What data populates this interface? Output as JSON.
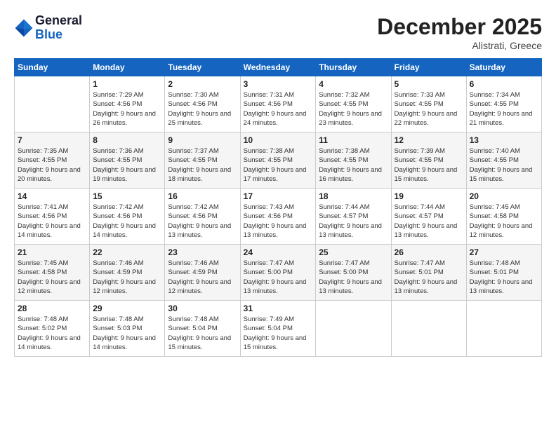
{
  "header": {
    "logo_line1": "General",
    "logo_line2": "Blue",
    "month": "December 2025",
    "location": "Alistrati, Greece"
  },
  "weekdays": [
    "Sunday",
    "Monday",
    "Tuesday",
    "Wednesday",
    "Thursday",
    "Friday",
    "Saturday"
  ],
  "weeks": [
    [
      {
        "day": "",
        "sunrise": "",
        "sunset": "",
        "daylight": ""
      },
      {
        "day": "1",
        "sunrise": "Sunrise: 7:29 AM",
        "sunset": "Sunset: 4:56 PM",
        "daylight": "Daylight: 9 hours and 26 minutes."
      },
      {
        "day": "2",
        "sunrise": "Sunrise: 7:30 AM",
        "sunset": "Sunset: 4:56 PM",
        "daylight": "Daylight: 9 hours and 25 minutes."
      },
      {
        "day": "3",
        "sunrise": "Sunrise: 7:31 AM",
        "sunset": "Sunset: 4:56 PM",
        "daylight": "Daylight: 9 hours and 24 minutes."
      },
      {
        "day": "4",
        "sunrise": "Sunrise: 7:32 AM",
        "sunset": "Sunset: 4:55 PM",
        "daylight": "Daylight: 9 hours and 23 minutes."
      },
      {
        "day": "5",
        "sunrise": "Sunrise: 7:33 AM",
        "sunset": "Sunset: 4:55 PM",
        "daylight": "Daylight: 9 hours and 22 minutes."
      },
      {
        "day": "6",
        "sunrise": "Sunrise: 7:34 AM",
        "sunset": "Sunset: 4:55 PM",
        "daylight": "Daylight: 9 hours and 21 minutes."
      }
    ],
    [
      {
        "day": "7",
        "sunrise": "Sunrise: 7:35 AM",
        "sunset": "Sunset: 4:55 PM",
        "daylight": "Daylight: 9 hours and 20 minutes."
      },
      {
        "day": "8",
        "sunrise": "Sunrise: 7:36 AM",
        "sunset": "Sunset: 4:55 PM",
        "daylight": "Daylight: 9 hours and 19 minutes."
      },
      {
        "day": "9",
        "sunrise": "Sunrise: 7:37 AM",
        "sunset": "Sunset: 4:55 PM",
        "daylight": "Daylight: 9 hours and 18 minutes."
      },
      {
        "day": "10",
        "sunrise": "Sunrise: 7:38 AM",
        "sunset": "Sunset: 4:55 PM",
        "daylight": "Daylight: 9 hours and 17 minutes."
      },
      {
        "day": "11",
        "sunrise": "Sunrise: 7:38 AM",
        "sunset": "Sunset: 4:55 PM",
        "daylight": "Daylight: 9 hours and 16 minutes."
      },
      {
        "day": "12",
        "sunrise": "Sunrise: 7:39 AM",
        "sunset": "Sunset: 4:55 PM",
        "daylight": "Daylight: 9 hours and 15 minutes."
      },
      {
        "day": "13",
        "sunrise": "Sunrise: 7:40 AM",
        "sunset": "Sunset: 4:55 PM",
        "daylight": "Daylight: 9 hours and 15 minutes."
      }
    ],
    [
      {
        "day": "14",
        "sunrise": "Sunrise: 7:41 AM",
        "sunset": "Sunset: 4:56 PM",
        "daylight": "Daylight: 9 hours and 14 minutes."
      },
      {
        "day": "15",
        "sunrise": "Sunrise: 7:42 AM",
        "sunset": "Sunset: 4:56 PM",
        "daylight": "Daylight: 9 hours and 14 minutes."
      },
      {
        "day": "16",
        "sunrise": "Sunrise: 7:42 AM",
        "sunset": "Sunset: 4:56 PM",
        "daylight": "Daylight: 9 hours and 13 minutes."
      },
      {
        "day": "17",
        "sunrise": "Sunrise: 7:43 AM",
        "sunset": "Sunset: 4:56 PM",
        "daylight": "Daylight: 9 hours and 13 minutes."
      },
      {
        "day": "18",
        "sunrise": "Sunrise: 7:44 AM",
        "sunset": "Sunset: 4:57 PM",
        "daylight": "Daylight: 9 hours and 13 minutes."
      },
      {
        "day": "19",
        "sunrise": "Sunrise: 7:44 AM",
        "sunset": "Sunset: 4:57 PM",
        "daylight": "Daylight: 9 hours and 13 minutes."
      },
      {
        "day": "20",
        "sunrise": "Sunrise: 7:45 AM",
        "sunset": "Sunset: 4:58 PM",
        "daylight": "Daylight: 9 hours and 12 minutes."
      }
    ],
    [
      {
        "day": "21",
        "sunrise": "Sunrise: 7:45 AM",
        "sunset": "Sunset: 4:58 PM",
        "daylight": "Daylight: 9 hours and 12 minutes."
      },
      {
        "day": "22",
        "sunrise": "Sunrise: 7:46 AM",
        "sunset": "Sunset: 4:59 PM",
        "daylight": "Daylight: 9 hours and 12 minutes."
      },
      {
        "day": "23",
        "sunrise": "Sunrise: 7:46 AM",
        "sunset": "Sunset: 4:59 PM",
        "daylight": "Daylight: 9 hours and 12 minutes."
      },
      {
        "day": "24",
        "sunrise": "Sunrise: 7:47 AM",
        "sunset": "Sunset: 5:00 PM",
        "daylight": "Daylight: 9 hours and 13 minutes."
      },
      {
        "day": "25",
        "sunrise": "Sunrise: 7:47 AM",
        "sunset": "Sunset: 5:00 PM",
        "daylight": "Daylight: 9 hours and 13 minutes."
      },
      {
        "day": "26",
        "sunrise": "Sunrise: 7:47 AM",
        "sunset": "Sunset: 5:01 PM",
        "daylight": "Daylight: 9 hours and 13 minutes."
      },
      {
        "day": "27",
        "sunrise": "Sunrise: 7:48 AM",
        "sunset": "Sunset: 5:01 PM",
        "daylight": "Daylight: 9 hours and 13 minutes."
      }
    ],
    [
      {
        "day": "28",
        "sunrise": "Sunrise: 7:48 AM",
        "sunset": "Sunset: 5:02 PM",
        "daylight": "Daylight: 9 hours and 14 minutes."
      },
      {
        "day": "29",
        "sunrise": "Sunrise: 7:48 AM",
        "sunset": "Sunset: 5:03 PM",
        "daylight": "Daylight: 9 hours and 14 minutes."
      },
      {
        "day": "30",
        "sunrise": "Sunrise: 7:48 AM",
        "sunset": "Sunset: 5:04 PM",
        "daylight": "Daylight: 9 hours and 15 minutes."
      },
      {
        "day": "31",
        "sunrise": "Sunrise: 7:49 AM",
        "sunset": "Sunset: 5:04 PM",
        "daylight": "Daylight: 9 hours and 15 minutes."
      },
      {
        "day": "",
        "sunrise": "",
        "sunset": "",
        "daylight": ""
      },
      {
        "day": "",
        "sunrise": "",
        "sunset": "",
        "daylight": ""
      },
      {
        "day": "",
        "sunrise": "",
        "sunset": "",
        "daylight": ""
      }
    ]
  ]
}
